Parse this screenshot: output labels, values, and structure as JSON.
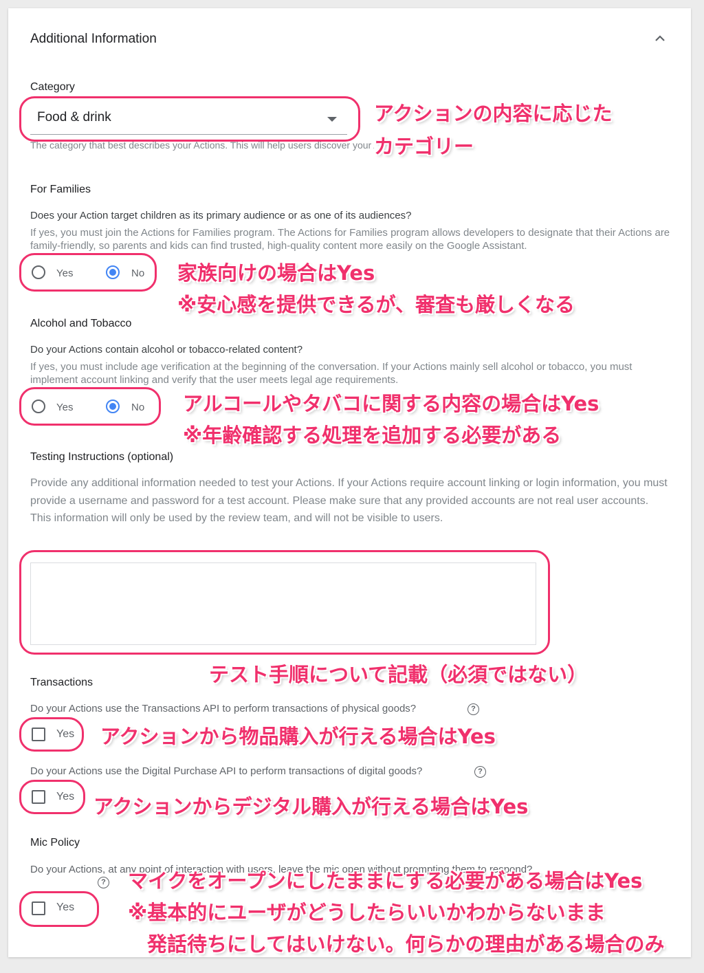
{
  "section": {
    "title": "Additional Information"
  },
  "category": {
    "label": "Category",
    "value": "Food & drink",
    "help": "The category that best describes your Actions. This will help users discover your Actions."
  },
  "families": {
    "label": "For Families",
    "question": "Does your Action target children as its primary audience or as one of its audiences?",
    "help": "If yes, you must join the Actions for Families program. The Actions for Families program allows developers to designate that their Actions are family-friendly, so parents and kids can find trusted, high-quality content more easily on the Google Assistant.",
    "yes": "Yes",
    "no": "No",
    "selected": "No"
  },
  "alcohol": {
    "label": "Alcohol and Tobacco",
    "question": "Do your Actions contain alcohol or tobacco-related content?",
    "help": "If yes, you must include age verification at the beginning of the conversation. If your Actions mainly sell alcohol or tobacco, you must implement account linking and verify that the user meets legal age requirements.",
    "yes": "Yes",
    "no": "No",
    "selected": "No"
  },
  "testing": {
    "label": "Testing Instructions (optional)",
    "help": "Provide any additional information needed to test your Actions. If your Actions require account linking or login information, you must provide a username and password for a test account. Please make sure that any provided accounts are not real user accounts. This information will only be used by the review team, and will not be visible to users.",
    "value": ""
  },
  "transactions": {
    "label": "Transactions",
    "q1": "Do your Actions use the Transactions API to perform transactions of physical goods?",
    "q1_yes": "Yes",
    "q2": "Do your Actions use the Digital Purchase API to perform transactions of digital goods?",
    "q2_yes": "Yes",
    "help_icon": "?"
  },
  "mic": {
    "label": "Mic Policy",
    "question": "Do your Actions, at any point of interaction with users, leave the mic open without prompting them to respond?",
    "yes": "Yes",
    "help_icon": "?"
  },
  "annotations": {
    "category_1": "アクションの内容に応じた",
    "category_2": "カテゴリー",
    "families_1": "家族向けの場合はYes",
    "families_2": "※安心感を提供できるが、審査も厳しくなる",
    "alcohol_1": "アルコールやタバコに関する内容の場合はYes",
    "alcohol_2": "※年齢確認する処理を追加する必要がある",
    "testing": "テスト手順について記載（必須ではない）",
    "trans_physical": "アクションから物品購入が行える場合はYes",
    "trans_digital": "アクションからデジタル購入が行える場合はYes",
    "mic_1": "マイクをオープンにしたままにする必要がある場合はYes",
    "mic_2": "※基本的にユーザがどうしたらいいかわからないまま",
    "mic_3": "発話待ちにしてはいけない。何らかの理由がある場合のみ"
  },
  "colors": {
    "annotation": "#f0306c",
    "radio_selected": "#4285f4"
  }
}
